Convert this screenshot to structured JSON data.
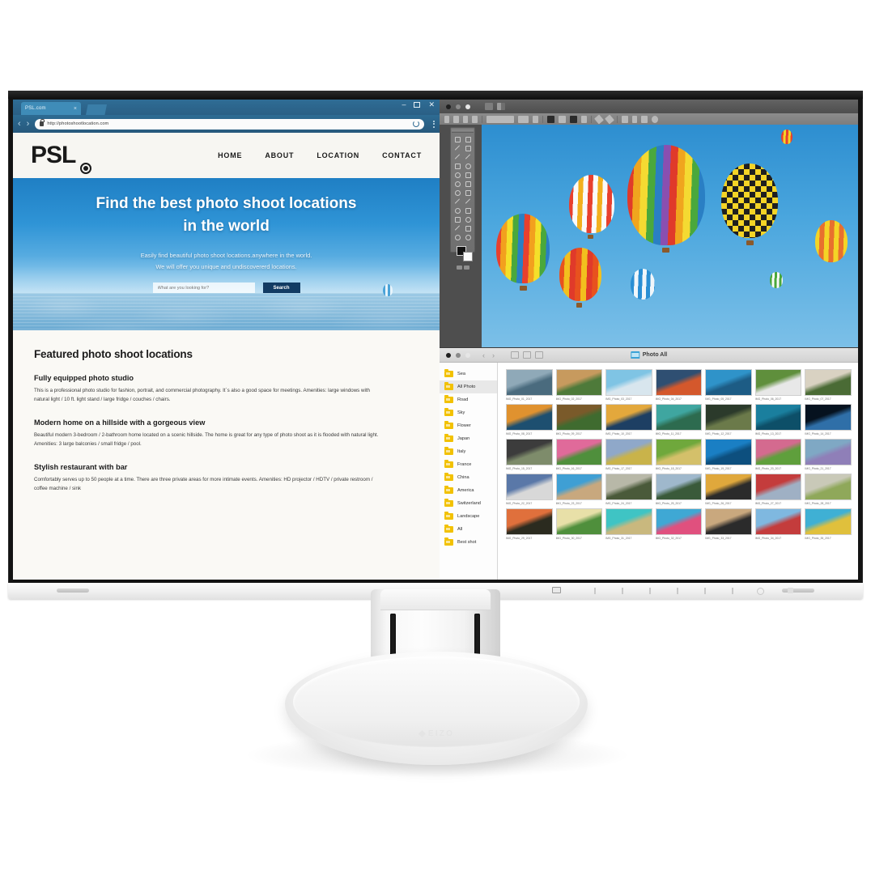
{
  "browser": {
    "tab_title": "PSL.com",
    "tab_close": "×",
    "url": "http://photoshootlocation.com",
    "back_icon": "‹",
    "forward_icon": "›",
    "minimize": "–",
    "close": "✕"
  },
  "site": {
    "logo": "PSL",
    "nav": [
      "HOME",
      "ABOUT",
      "LOCATION",
      "CONTACT"
    ],
    "hero": {
      "heading_line1": "Find the best photo shoot locations",
      "heading_line2": "in the world",
      "sub_line1": "Easily find beautiful photo shoot locations.anywhere in the world.",
      "sub_line2": "We will offer you unique and undiscovererd locations.",
      "search_placeholder": "What are you looking for?",
      "search_value": "",
      "search_button": "Search"
    },
    "featured": {
      "title": "Featured photo shoot locations",
      "items": [
        {
          "heading": "Fully equipped photo studio",
          "body": "This is a professional photo studio for fashion, portrait, and commercial photography. It´s also a good space for meetings. Amenities: large windows with natural light / 10 ft. light stand / large fridge / couches / chairs."
        },
        {
          "heading": "Modern home on a hillside with a gorgeous view",
          "body": "Beautiful modern 3-bedroom / 2-bathroom home located on a scenic hillside. The home is great for any type of photo shoot as it is flooded with natural light. Amenities: 3 large balconies / small fridge / pool."
        },
        {
          "heading": "Stylish restaurant with bar",
          "body": "Comfortably serves up to 50 people at a time. There are three private areas for more intimate events. Amenities: HD projector / HDTV / private restroom / coffee machine / sink"
        }
      ]
    }
  },
  "editor": {
    "window_dots": [
      "close",
      "minimize",
      "zoom"
    ],
    "subject": "hot air balloons over blue sky"
  },
  "finder": {
    "title": "Photo All",
    "back_icon": "‹",
    "forward_icon": "›",
    "sidebar": [
      "Sea",
      "All Photo",
      "Road",
      "Sky",
      "Flower",
      "Japan",
      "Italy",
      "France",
      "China",
      "America",
      "Switzerland",
      "Landscape",
      "All",
      "Best shot"
    ],
    "selected_sidebar_item": "All Photo",
    "thumbnails": [
      {
        "caption": "IMG_Photo_01_2017",
        "c1": "#8fa9b8",
        "c2": "#4a6b7e"
      },
      {
        "caption": "IMG_Photo_02_2017",
        "c1": "#c79a5e",
        "c2": "#4e7a3a"
      },
      {
        "caption": "IMG_Photo_03_2017",
        "c1": "#7fc4e4",
        "c2": "#d8e6ee"
      },
      {
        "caption": "IMG_Photo_04_2017",
        "c1": "#2f4f72",
        "c2": "#d4582c"
      },
      {
        "caption": "IMG_Photo_05_2017",
        "c1": "#2f93c9",
        "c2": "#1d5c85"
      },
      {
        "caption": "IMG_Photo_06_2017",
        "c1": "#5f8f3c",
        "c2": "#e8e8e8"
      },
      {
        "caption": "IMG_Photo_07_2017",
        "c1": "#d9d2c2",
        "c2": "#4a6b35"
      },
      {
        "caption": "IMG_Photo_08_2017",
        "c1": "#e0922f",
        "c2": "#1d4f70"
      },
      {
        "caption": "IMG_Photo_09_2017",
        "c1": "#7a5a2a",
        "c2": "#3f6b2f"
      },
      {
        "caption": "IMG_Photo_10_2017",
        "c1": "#e3a83c",
        "c2": "#1d3f63"
      },
      {
        "caption": "IMG_Photo_11_2017",
        "c1": "#3fa6a0",
        "c2": "#2d6b4f"
      },
      {
        "caption": "IMG_Photo_12_2017",
        "c1": "#2b3a2b",
        "c2": "#6b7a4a"
      },
      {
        "caption": "IMG_Photo_13_2017",
        "c1": "#1a7f9e",
        "c2": "#0d4f68"
      },
      {
        "caption": "IMG_Photo_14_2017",
        "c1": "#06121f",
        "c2": "#2f6fa8"
      },
      {
        "caption": "IMG_Photo_15_2017",
        "c1": "#3c3c3c",
        "c2": "#7e8c6b"
      },
      {
        "caption": "IMG_Photo_16_2017",
        "c1": "#e06a9a",
        "c2": "#4f8f3c"
      },
      {
        "caption": "IMG_Photo_17_2017",
        "c1": "#8fa8c9",
        "c2": "#c9b34a"
      },
      {
        "caption": "IMG_Photo_18_2017",
        "c1": "#6fa83c",
        "c2": "#d4c06a"
      },
      {
        "caption": "IMG_Photo_19_2017",
        "c1": "#1a7fc4",
        "c2": "#0d4f7e"
      },
      {
        "caption": "IMG_Photo_20_2017",
        "c1": "#d46a8f",
        "c2": "#5f9f3c"
      },
      {
        "caption": "IMG_Photo_21_2017",
        "c1": "#7fa8c4",
        "c2": "#8f7fb8"
      },
      {
        "caption": "IMG_Photo_22_2017",
        "c1": "#5a78a8",
        "c2": "#d8d8d8"
      },
      {
        "caption": "IMG_Photo_23_2017",
        "c1": "#3f9fd4",
        "c2": "#c8a87e"
      },
      {
        "caption": "IMG_Photo_24_2017",
        "c1": "#b8b8a8",
        "c2": "#4a5a3a"
      },
      {
        "caption": "IMG_Photo_25_2017",
        "c1": "#9fb8cc",
        "c2": "#3a5a3a"
      },
      {
        "caption": "IMG_Photo_26_2017",
        "c1": "#e0a83c",
        "c2": "#2b2b2b"
      },
      {
        "caption": "IMG_Photo_27_2017",
        "c1": "#c43c3c",
        "c2": "#9fb0c4"
      },
      {
        "caption": "IMG_Photo_28_2017",
        "c1": "#c9c9b8",
        "c2": "#8fa85a"
      },
      {
        "caption": "IMG_Photo_29_2017",
        "c1": "#e0703c",
        "c2": "#2b2b1f"
      },
      {
        "caption": "IMG_Photo_30_2017",
        "c1": "#e8e0a8",
        "c2": "#4f8f3c"
      },
      {
        "caption": "IMG_Photo_31_2017",
        "c1": "#3fc4c4",
        "c2": "#c9b87e"
      },
      {
        "caption": "IMG_Photo_32_2017",
        "c1": "#3fa8d4",
        "c2": "#e0507e"
      },
      {
        "caption": "IMG_Photo_33_2017",
        "c1": "#c9a87e",
        "c2": "#2b2b2b"
      },
      {
        "caption": "IMG_Photo_34_2017",
        "c1": "#7fb8e0",
        "c2": "#c43c3c"
      },
      {
        "caption": "IMG_Photo_35_2017",
        "c1": "#3fb0d4",
        "c2": "#e0c03c"
      }
    ]
  },
  "monitor": {
    "brand": "EIZO"
  },
  "colors": {
    "browser_chrome": "#2d6b93",
    "site_bg": "#faf9f5",
    "hero_sky": "#2f94d6",
    "search_button": "#123b63",
    "folder_yellow": "#f2c100"
  }
}
